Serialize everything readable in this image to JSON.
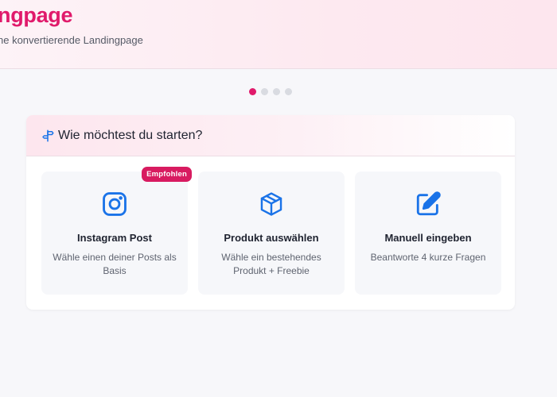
{
  "header": {
    "title": "ngpage",
    "subtitle": "ne konvertierende Landingpage"
  },
  "steps": {
    "count": 4,
    "active_index": 0
  },
  "start_card": {
    "icon": "signpost-icon",
    "title": "Wie möchtest du starten?",
    "options": [
      {
        "icon": "instagram-icon",
        "title": "Instagram Post",
        "description": "Wähle einen deiner Posts als Basis",
        "badge": "Empfohlen"
      },
      {
        "icon": "package-icon",
        "title": "Produkt auswählen",
        "description": "Wähle ein bestehendes Produkt + Freebie"
      },
      {
        "icon": "edit-icon",
        "title": "Manuell eingeben",
        "description": "Beantworte 4 kurze Fragen"
      }
    ]
  },
  "colors": {
    "accent": "#e01a6b",
    "badge": "#d81b60",
    "icon_blue": "#1a73e8"
  }
}
